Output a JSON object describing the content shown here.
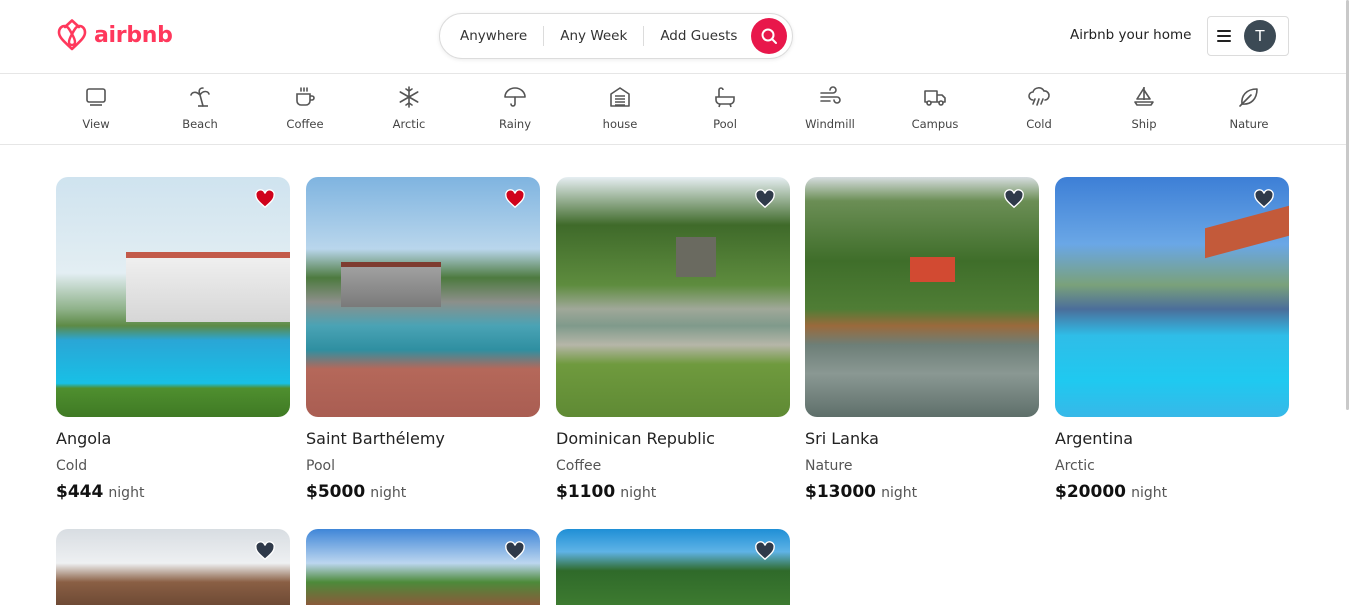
{
  "header": {
    "logo_text": "airbnb",
    "search": {
      "where": "Anywhere",
      "when": "Any Week",
      "who": "Add Guests"
    },
    "host_link": "Airbnb your home",
    "avatar_initial": "T"
  },
  "categories": [
    {
      "label": "View",
      "icon": "view-icon"
    },
    {
      "label": "Beach",
      "icon": "palm-tree-icon"
    },
    {
      "label": "Coffee",
      "icon": "coffee-cup-icon"
    },
    {
      "label": "Arctic",
      "icon": "snowflake-icon"
    },
    {
      "label": "Rainy",
      "icon": "umbrella-icon"
    },
    {
      "label": "house",
      "icon": "house-icon"
    },
    {
      "label": "Pool",
      "icon": "bathtub-icon"
    },
    {
      "label": "Windmill",
      "icon": "wind-icon"
    },
    {
      "label": "Campus",
      "icon": "truck-icon"
    },
    {
      "label": "Cold",
      "icon": "cloud-rain-icon"
    },
    {
      "label": "Ship",
      "icon": "sailboat-icon"
    },
    {
      "label": "Nature",
      "icon": "leaf-icon"
    }
  ],
  "listings": [
    {
      "title": "Angola",
      "category": "Cold",
      "price": "$444",
      "per": "night",
      "favorited": true
    },
    {
      "title": "Saint Barthélemy",
      "category": "Pool",
      "price": "$5000",
      "per": "night",
      "favorited": true
    },
    {
      "title": "Dominican Republic",
      "category": "Coffee",
      "price": "$1100",
      "per": "night",
      "favorited": false
    },
    {
      "title": "Sri Lanka",
      "category": "Nature",
      "price": "$13000",
      "per": "night",
      "favorited": false
    },
    {
      "title": "Argentina",
      "category": "Arctic",
      "price": "$20000",
      "per": "night",
      "favorited": false
    },
    {
      "favorited": false
    },
    {
      "favorited": false
    },
    {
      "favorited": false
    }
  ],
  "colors": {
    "brand": "#ff385c",
    "search_button": "#e8174b",
    "heart_favorited": "#d0021b",
    "heart_default": "#2f3a4a"
  }
}
